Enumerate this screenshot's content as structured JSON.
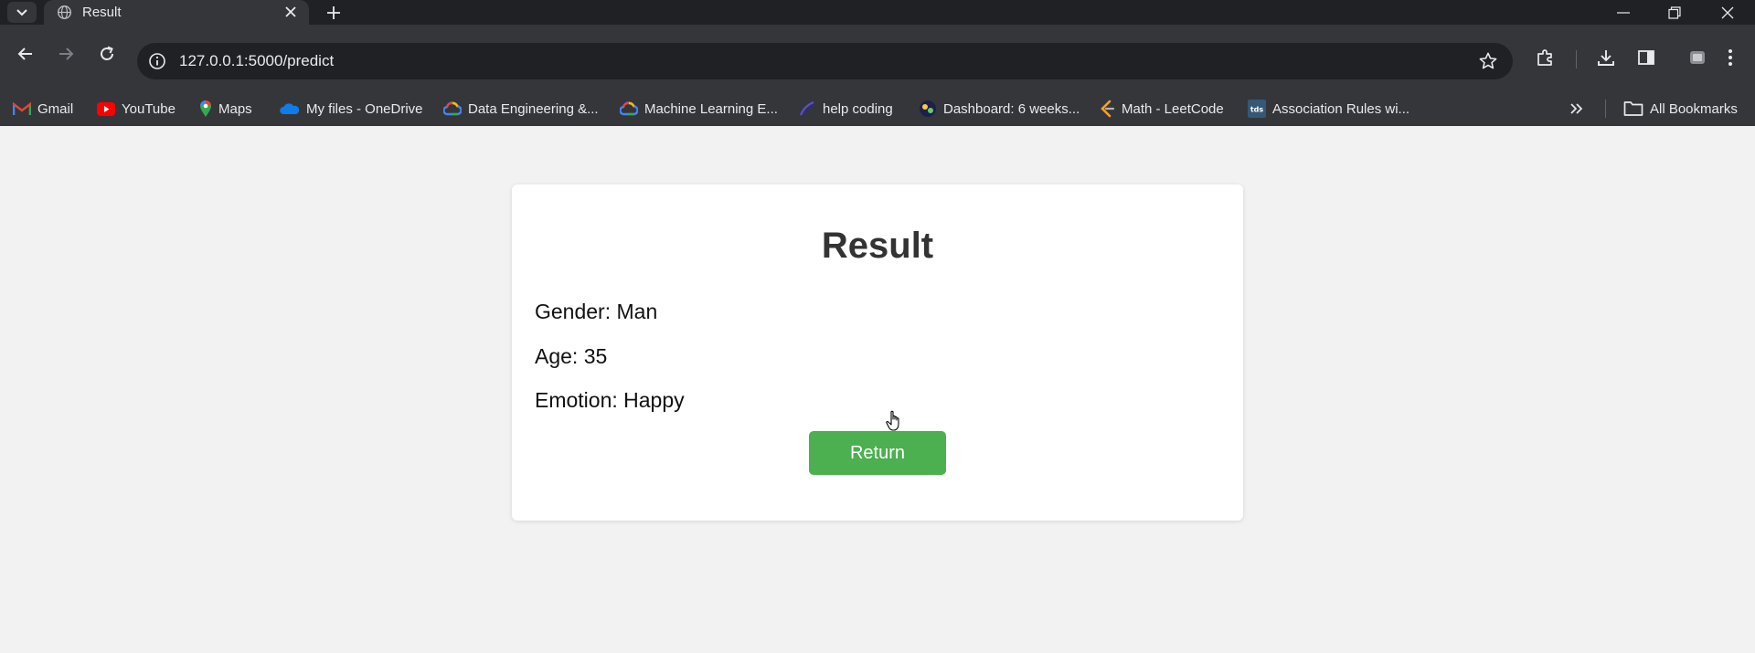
{
  "browser": {
    "tab": {
      "title": "Result"
    },
    "address_bar": {
      "url": "127.0.0.1:5000/predict"
    },
    "bookmarks": [
      {
        "label": "Gmail",
        "icon": "gmail-icon"
      },
      {
        "label": "YouTube",
        "icon": "youtube-icon"
      },
      {
        "label": "Maps",
        "icon": "maps-icon"
      },
      {
        "label": "My files - OneDrive",
        "icon": "onedrive-icon"
      },
      {
        "label": "Data Engineering &...",
        "icon": "google-cloud-icon"
      },
      {
        "label": "Machine Learning E...",
        "icon": "google-cloud-icon"
      },
      {
        "label": "help coding",
        "icon": "link-icon"
      },
      {
        "label": "Dashboard: 6 weeks...",
        "icon": "dashboard-site-icon"
      },
      {
        "label": "Math - LeetCode",
        "icon": "leetcode-icon"
      },
      {
        "label": "Association Rules wi...",
        "icon": "tds-icon"
      }
    ],
    "all_bookmarks_label": "All Bookmarks",
    "tds_icon_text": "tds"
  },
  "page": {
    "title": "Result",
    "fields": [
      {
        "text": "Gender: Man"
      },
      {
        "text": "Age: 35"
      },
      {
        "text": "Emotion: Happy"
      }
    ],
    "return_button": "Return",
    "colors": {
      "background": "#f2f2f2",
      "card": "#ffffff",
      "button": "#4caf50",
      "title": "#333333"
    }
  }
}
